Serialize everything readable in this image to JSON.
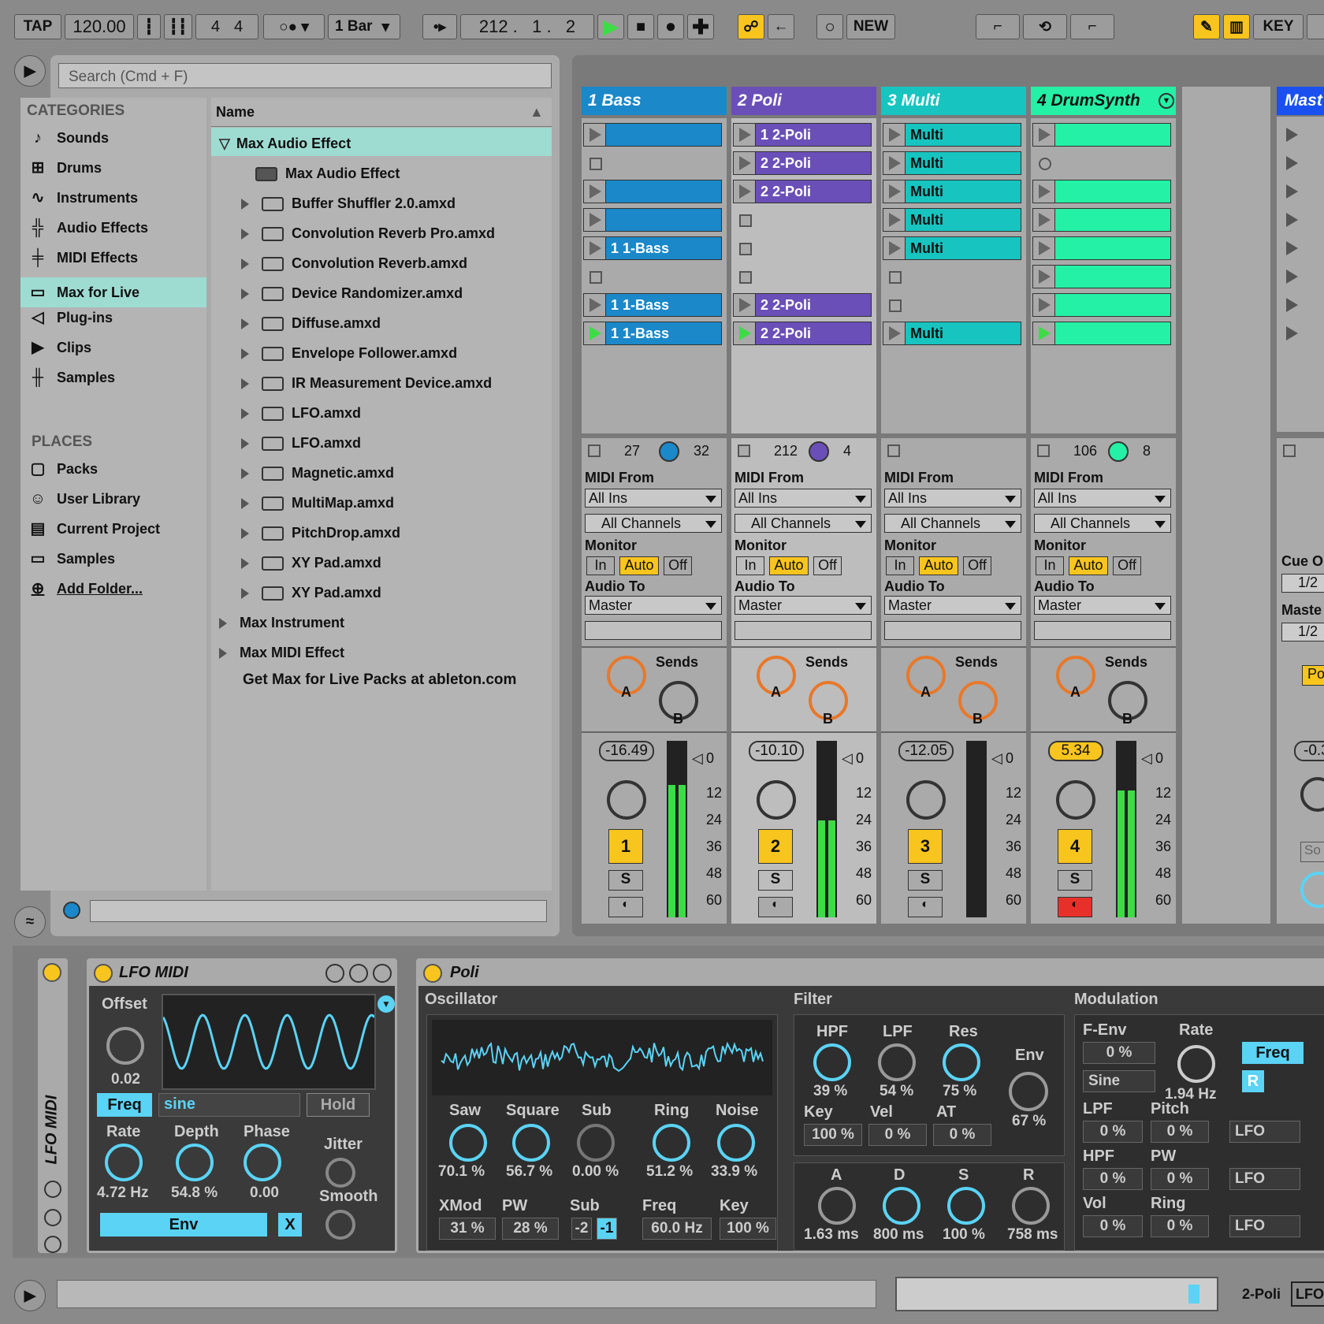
{
  "transport": {
    "tap": "TAP",
    "tempo": "120.00",
    "signature_num": "4",
    "signature_den": "4",
    "quantize": "1 Bar",
    "position": "212 .   1 .   2",
    "new": "NEW",
    "key": "KEY"
  },
  "browser": {
    "search_placeholder": "Search (Cmd + F)",
    "categories_title": "CATEGORIES",
    "categories": [
      "Sounds",
      "Drums",
      "Instruments",
      "Audio Effects",
      "MIDI Effects",
      "Max for Live",
      "Plug-ins",
      "Clips",
      "Samples"
    ],
    "places_title": "PLACES",
    "places": [
      "Packs",
      "User Library",
      "Current Project",
      "Samples",
      "Add Folder..."
    ],
    "name_header": "Name",
    "items": [
      {
        "label": "Max Audio Effect",
        "level": 0,
        "open": true
      },
      {
        "label": "Max Audio Effect",
        "level": 1
      },
      {
        "label": "Buffer Shuffler 2.0.amxd",
        "level": 1
      },
      {
        "label": "Convolution Reverb Pro.amxd",
        "level": 1
      },
      {
        "label": "Convolution Reverb.amxd",
        "level": 1
      },
      {
        "label": "Device Randomizer.amxd",
        "level": 1
      },
      {
        "label": "Diffuse.amxd",
        "level": 1
      },
      {
        "label": "Envelope Follower.amxd",
        "level": 1
      },
      {
        "label": "IR Measurement Device.amxd",
        "level": 1
      },
      {
        "label": "LFO.amxd",
        "level": 1
      },
      {
        "label": "LFO.amxd",
        "level": 1
      },
      {
        "label": "Magnetic.amxd",
        "level": 1
      },
      {
        "label": "MultiMap.amxd",
        "level": 1
      },
      {
        "label": "PitchDrop.amxd",
        "level": 1
      },
      {
        "label": "XY Pad.amxd",
        "level": 1
      },
      {
        "label": "XY Pad.amxd",
        "level": 1
      },
      {
        "label": "Max Instrument",
        "level": 0
      },
      {
        "label": "Max MIDI Effect",
        "level": 0
      }
    ],
    "footer": "Get Max for Live Packs at ableton.com"
  },
  "tracks": [
    {
      "name": "1 Bass",
      "color": "#1a88c9",
      "clips": [
        "",
        "",
        "",
        " ",
        "1 1-Bass",
        "",
        "1 1-Bass",
        "1 1-Bass"
      ],
      "io_a": "27",
      "io_b": "32",
      "volume": "-16.49",
      "number": "1",
      "meter": 0.75
    },
    {
      "name": "2 Poli",
      "color": "#6b4fb8",
      "clips": [
        "1 2-Poli",
        "2 2-Poli",
        "2 2-Poli",
        "",
        "",
        "",
        "2 2-Poli",
        "2 2-Poli"
      ],
      "io_a": "212",
      "io_b": "4",
      "volume": "-10.10",
      "number": "2",
      "meter": 0.55
    },
    {
      "name": "3 Multi",
      "color": "#17c4c0",
      "clips": [
        "Multi",
        "Multi",
        "Multi",
        "Multi",
        "Multi",
        "",
        "",
        "Multi"
      ],
      "io_a": "",
      "io_b": "",
      "volume": "-12.05",
      "number": "3",
      "meter": 0
    },
    {
      "name": "4 DrumSynth",
      "color": "#24f0a6",
      "clips": [
        "",
        "",
        "",
        "",
        "",
        "",
        "",
        ""
      ],
      "io_a": "106",
      "io_b": "8",
      "volume": "5.34",
      "number": "4",
      "meter": 0.72
    }
  ],
  "master": {
    "name": "Mast",
    "cue": "Cue O",
    "cue_val": "1/2",
    "master_lbl": "Maste",
    "master_val": "1/2",
    "volume": "-0.3",
    "po": "Po",
    "so": "So"
  },
  "io": {
    "midi_from": "MIDI From",
    "all_ins": "All Ins",
    "all_channels": "All Channels",
    "monitor": "Monitor",
    "in": "In",
    "auto": "Auto",
    "off": "Off",
    "audio_to": "Audio To",
    "master": "Master",
    "sends": "Sends",
    "a": "A",
    "b": "B",
    "s": "S",
    "db": [
      "0",
      "12",
      "24",
      "36",
      "48",
      "60"
    ]
  },
  "lfo": {
    "vertical": "LFO MIDI",
    "title": "LFO MIDI",
    "offset": "Offset",
    "offset_val": "0.02",
    "freq": "Freq",
    "wave": "sine",
    "hold": "Hold",
    "rate": "Rate",
    "rate_val": "4.72 Hz",
    "depth": "Depth",
    "depth_val": "54.8 %",
    "phase": "Phase",
    "phase_val": "0.00",
    "jitter": "Jitter",
    "smooth": "Smooth",
    "env": "Env",
    "x": "X"
  },
  "poli": {
    "title": "Poli",
    "oscillator": "Oscillator",
    "saw": "Saw",
    "saw_val": "70.1 %",
    "square": "Square",
    "square_val": "56.7 %",
    "sub": "Sub",
    "sub_val": "0.00 %",
    "ring": "Ring",
    "ring_val": "51.2 %",
    "noise": "Noise",
    "noise_val": "33.9 %",
    "xmod": "XMod",
    "xmod_val": "31 %",
    "pw": "PW",
    "pw_val": "28 %",
    "sub2": "Sub",
    "sub_m2": "-2",
    "sub_m1": "-1",
    "freq": "Freq",
    "freq_val": "60.0 Hz",
    "key": "Key",
    "key_val": "100 %",
    "filter": "Filter",
    "hpf": "HPF",
    "hpf_val": "39 %",
    "lpf": "LPF",
    "lpf_val": "54 %",
    "res": "Res",
    "res_val": "75 %",
    "env": "Env",
    "env_val": "67 %",
    "fkey": "Key",
    "fkey_val": "100 %",
    "vel": "Vel",
    "vel_val": "0 %",
    "at": "AT",
    "at_val": "0 %",
    "a": "A",
    "a_val": "1.63 ms",
    "d": "D",
    "d_val": "800 ms",
    "s": "S",
    "s_val": "100 %",
    "r": "R",
    "r_val": "758 ms",
    "modulation": "Modulation",
    "fenv": "F-Env",
    "fenv_val": "0 %",
    "mrate": "Rate",
    "mrate_val": "1.94 Hz",
    "mfreq": "Freq",
    "sine": "Sine",
    "r_btn": "R",
    "mlpf": "LPF",
    "mlpf_val": "0 %",
    "pitch": "Pitch",
    "pitch_val": "0 %",
    "mhpf": "HPF",
    "mhpf_val": "0 %",
    "mpw": "PW",
    "mpw_val": "0 %",
    "vol": "Vol",
    "vol_val": "0 %",
    "mring": "Ring",
    "mring_val": "0 %",
    "lfo": "LFO"
  },
  "statusbar": {
    "track": "2-Poli",
    "lfo": "LFO"
  }
}
